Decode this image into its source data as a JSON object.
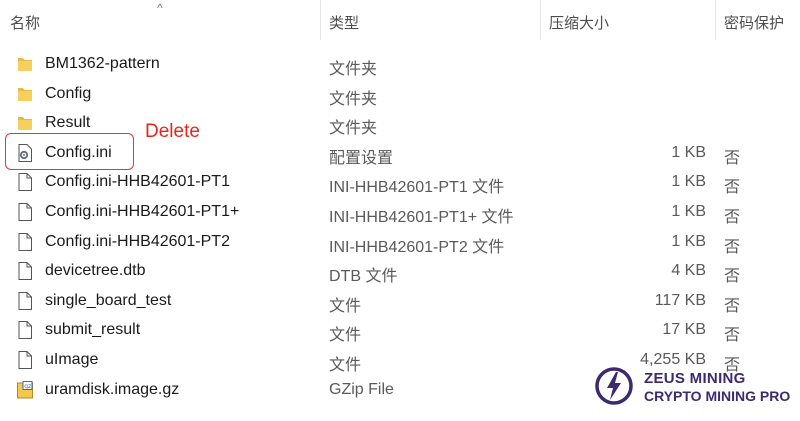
{
  "columns": {
    "name": "名称",
    "type": "类型",
    "size": "压缩大小",
    "protected": "密码保护"
  },
  "files": [
    {
      "icon": "folder-icon",
      "name": "BM1362-pattern",
      "type": "文件夹",
      "size": "",
      "protected": ""
    },
    {
      "icon": "folder-icon",
      "name": "Config",
      "type": "文件夹",
      "size": "",
      "protected": ""
    },
    {
      "icon": "folder-icon",
      "name": "Result",
      "type": "文件夹",
      "size": "",
      "protected": ""
    },
    {
      "icon": "settings-file-icon",
      "name": "Config.ini",
      "type": "配置设置",
      "size": "1 KB",
      "protected": "否"
    },
    {
      "icon": "file-icon",
      "name": "Config.ini-HHB42601-PT1",
      "type": "INI-HHB42601-PT1 文件",
      "size": "1 KB",
      "protected": "否"
    },
    {
      "icon": "file-icon",
      "name": "Config.ini-HHB42601-PT1+",
      "type": "INI-HHB42601-PT1+ 文件",
      "size": "1 KB",
      "protected": "否"
    },
    {
      "icon": "file-icon",
      "name": "Config.ini-HHB42601-PT2",
      "type": "INI-HHB42601-PT2 文件",
      "size": "1 KB",
      "protected": "否"
    },
    {
      "icon": "file-icon",
      "name": "devicetree.dtb",
      "type": "DTB 文件",
      "size": "4 KB",
      "protected": "否"
    },
    {
      "icon": "file-icon",
      "name": "single_board_test",
      "type": "文件",
      "size": "117 KB",
      "protected": "否"
    },
    {
      "icon": "file-icon",
      "name": "submit_result",
      "type": "文件",
      "size": "17 KB",
      "protected": "否"
    },
    {
      "icon": "file-icon",
      "name": "uImage",
      "type": "文件",
      "size": "4,255 KB",
      "protected": "否"
    },
    {
      "icon": "gzip-archive-icon",
      "name": "uramdisk.image.gz",
      "type": "GZip File",
      "size": "",
      "protected": ""
    }
  ],
  "annotation": {
    "text": "Delete",
    "color": "#e8251a"
  },
  "watermark": {
    "line1": "ZEUS MINING",
    "line2": "CRYPTO MINING PRO",
    "color": "#3d2a6e"
  }
}
